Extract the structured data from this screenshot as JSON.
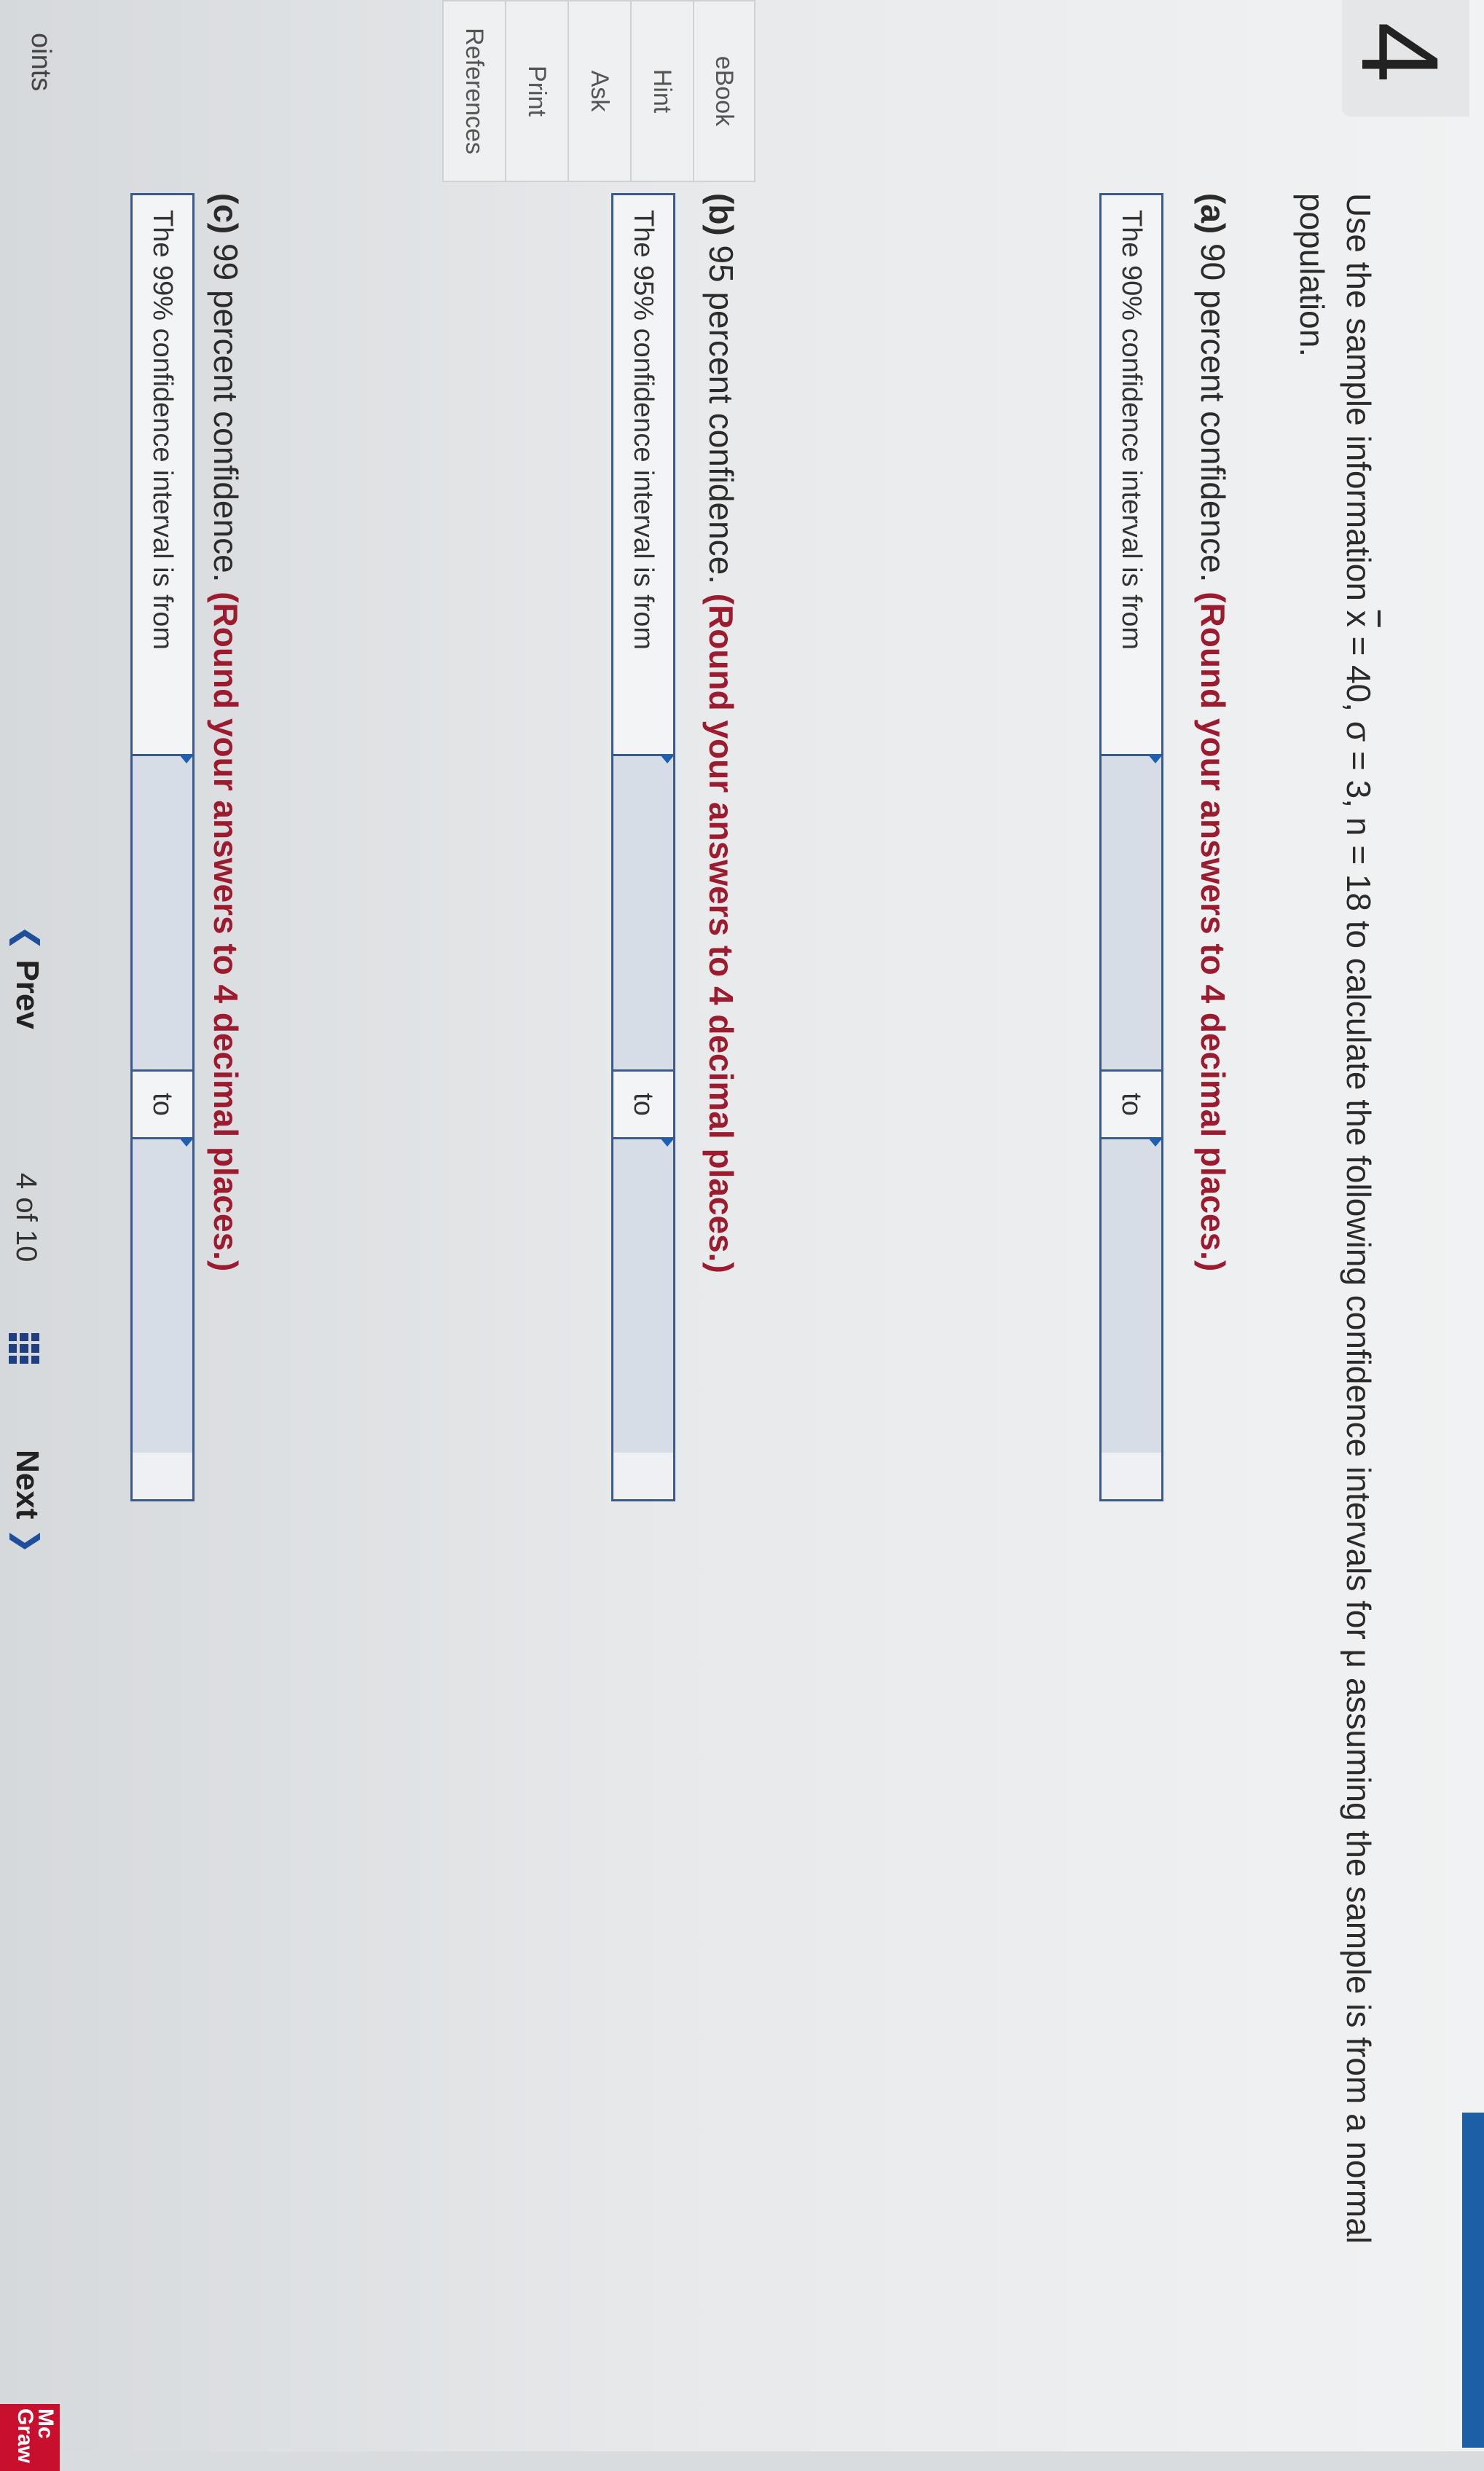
{
  "question": {
    "number": "4",
    "points_label": "oints",
    "prompt_before": "Use the sample information ",
    "xbar_symbol": "x",
    "prompt_after": " = 40, σ = 3, n = 18 to calculate the following confidence intervals for μ assuming the sample is from a normal population."
  },
  "side_panel": {
    "items": [
      {
        "label": "eBook"
      },
      {
        "label": "Hint"
      },
      {
        "label": "Ask"
      },
      {
        "label": "Print"
      },
      {
        "label": "References"
      }
    ]
  },
  "parts": [
    {
      "part_label": "(a)",
      "part_text": " 90 percent confidence. ",
      "round_note": "(Round your answers to 4 decimal places.)",
      "interval_label": "The 90% confidence interval is from",
      "to_label": "to",
      "lower_value": "",
      "upper_value": ""
    },
    {
      "part_label": "(b)",
      "part_text": " 95 percent confidence. ",
      "round_note": "(Round your answers to 4 decimal places.)",
      "interval_label": "The 95% confidence interval is from",
      "to_label": "to",
      "lower_value": "",
      "upper_value": ""
    },
    {
      "part_label": "(c)",
      "part_text": " 99 percent confidence. ",
      "round_note": "(Round your answers to 4 decimal places.)",
      "interval_label": "The 99% confidence interval is from",
      "to_label": "to",
      "lower_value": "",
      "upper_value": ""
    }
  ],
  "nav": {
    "prev_label": "Prev",
    "page_current": "4",
    "page_of": "of",
    "page_total": "10",
    "next_label": "Next"
  },
  "brand": {
    "line1": "Mc",
    "line2": "Graw"
  },
  "colors": {
    "accent": "#1d5fa6",
    "round_note": "#9b1b2f",
    "brand": "#c8102e"
  }
}
